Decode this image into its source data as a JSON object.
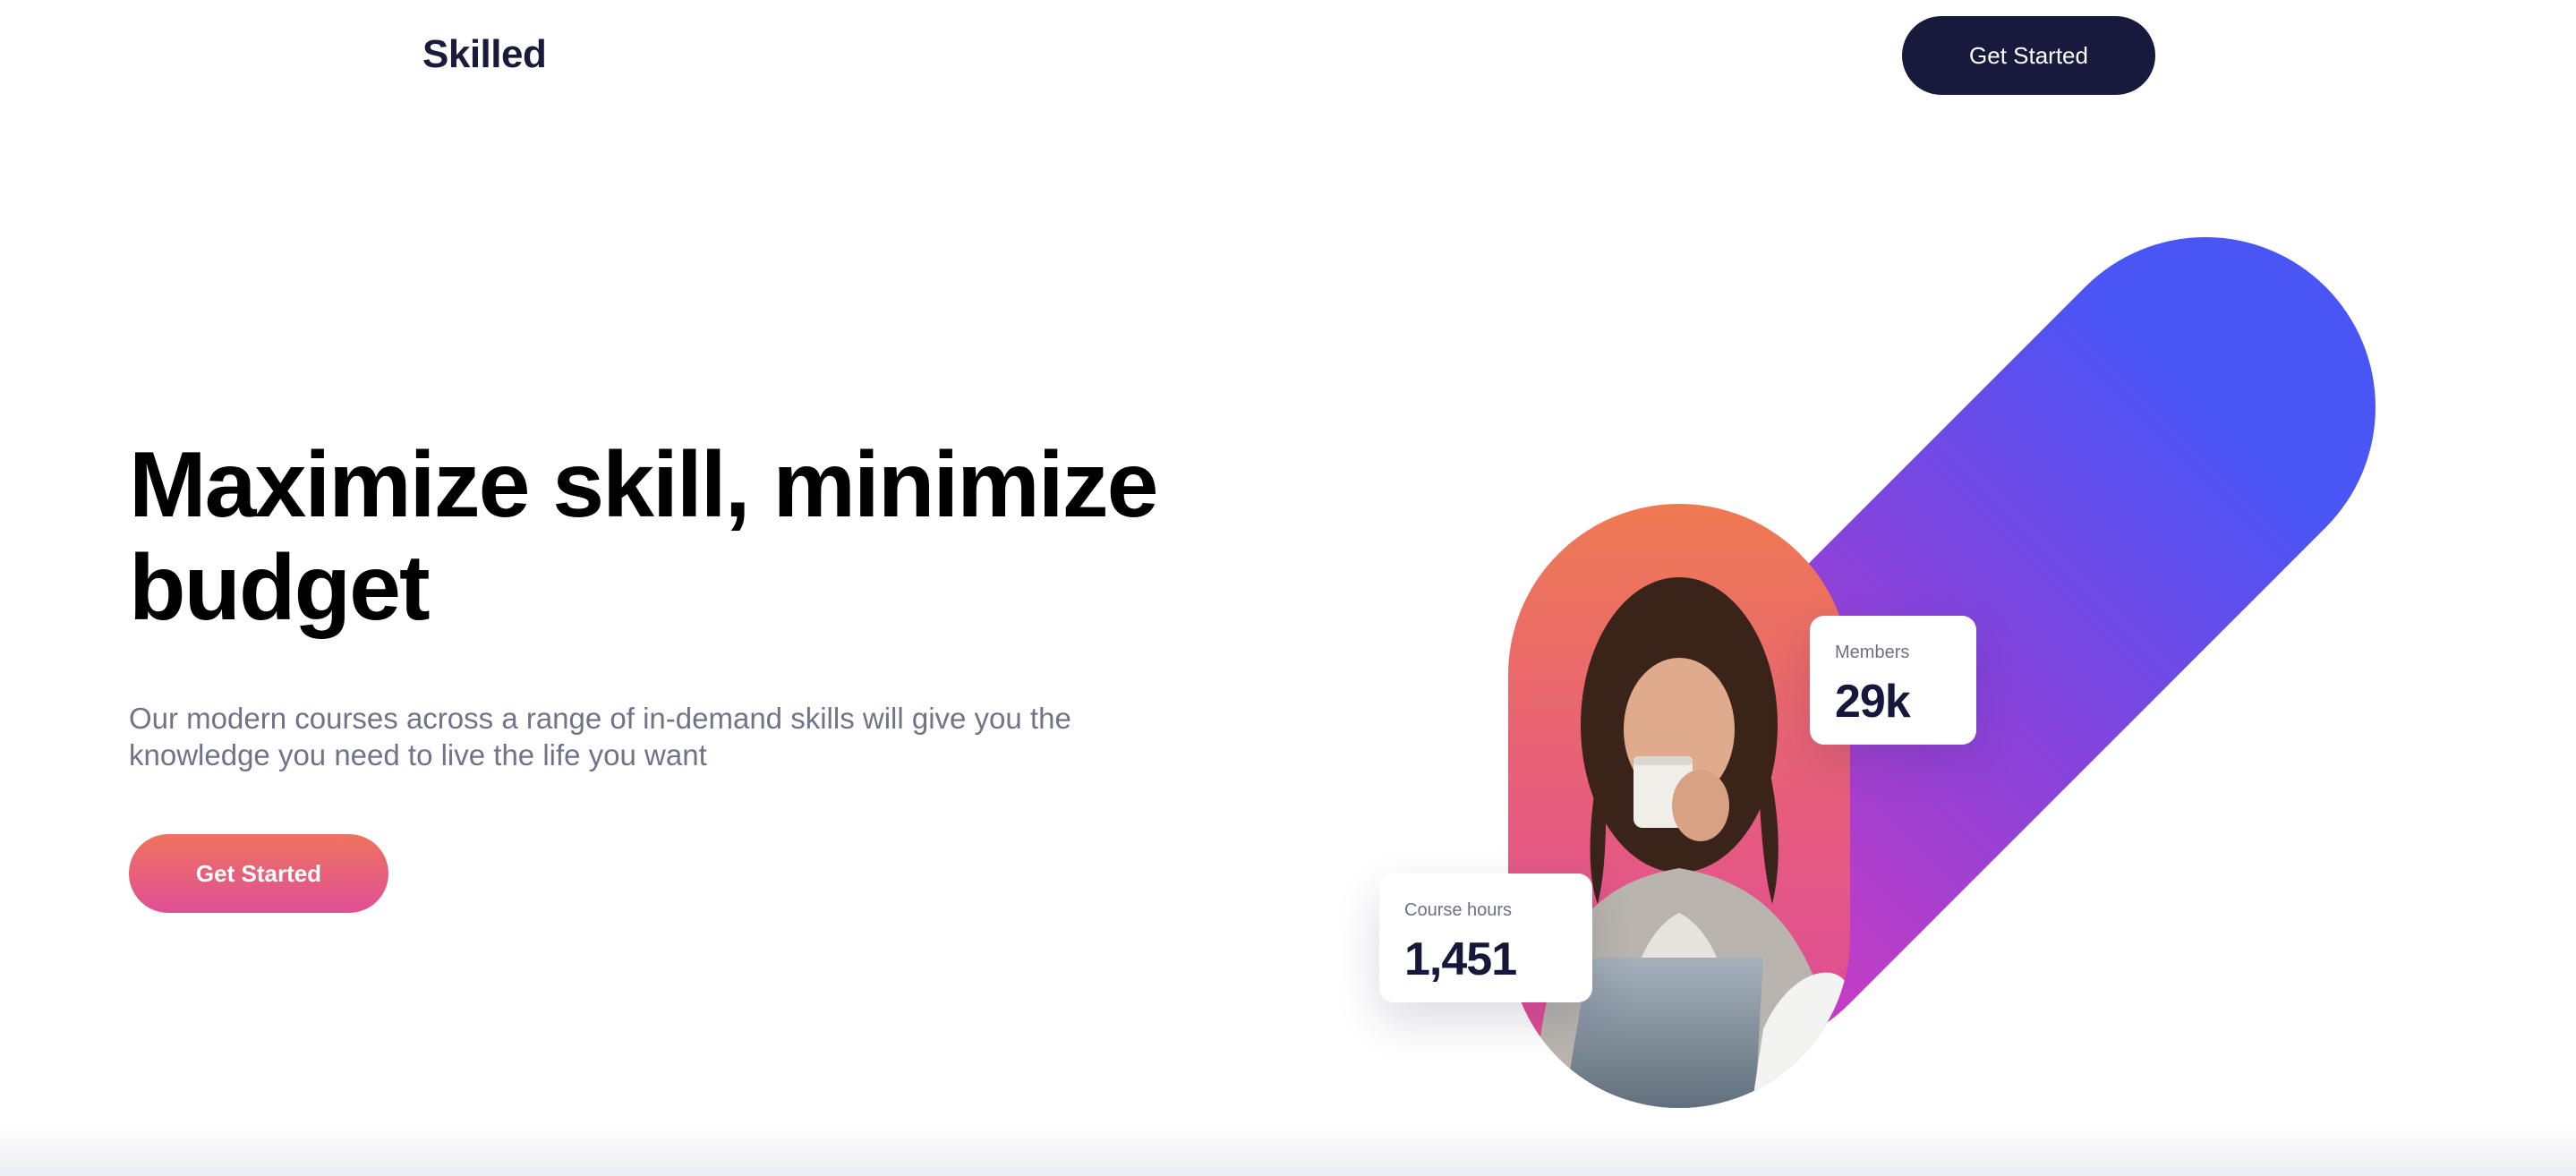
{
  "header": {
    "logo": "Skilled",
    "cta_label": "Get Started"
  },
  "hero": {
    "title": "Maximize skill, minimize budget",
    "subtitle": "Our modern courses across a range of in-demand skills will give you the knowledge you need to live the life you want",
    "cta_label": "Get Started"
  },
  "stats": {
    "members": {
      "label": "Members",
      "value": "29k"
    },
    "course_hours": {
      "label": "Course hours",
      "value": "1,451"
    }
  },
  "colors": {
    "brand_navy": "#171a3d",
    "cta_gradient_start": "#ee735c",
    "cta_gradient_end": "#e04f97",
    "capsule_blue": "#4b55f3",
    "capsule_purple": "#a43fd6",
    "text_muted": "#707489"
  }
}
